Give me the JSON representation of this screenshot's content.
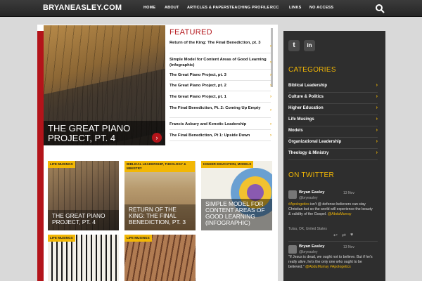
{
  "header": {
    "logo": "BRYANEASLEY.COM",
    "nav": [
      "HOME",
      "ABOUT",
      "ARTICLES & PAPERS",
      "TEACHING PROFILE",
      "RCC",
      "LINKS",
      "NO ACCESS"
    ],
    "search_icon": "search-icon"
  },
  "hero": {
    "title": "THE GREAT PIANO PROJECT, PT. 4",
    "next_icon": "chevron-right-icon"
  },
  "featured": {
    "heading": "FEATURED",
    "items": [
      "Return of the King: The Final Benediction, pt. 3",
      "Simple Model for Content Areas of Good Learning (infographic)",
      "The Great Piano Project, pt. 3",
      "The Great Piano Project, pt. 2",
      "The Great Piano Project, pt. 1",
      "The Final Benediction, Pt. 2: Coming Up Empty",
      "Francis Asbury and Kenotic Leadership",
      "The Final Benediction, Pt 1: Upside Down"
    ]
  },
  "cards": [
    {
      "tag": "LIFE MUSINGS",
      "title": "THE GREAT PIANO PROJECT, PT. 4"
    },
    {
      "tag": "BIBLICAL LEADERSHIP, THEOLOGY & MINISTRY",
      "title": "RETURN OF THE KING: THE FINAL BENEDICTION, PT. 3"
    },
    {
      "tag": "HIGHER EDUCATION, MODELS",
      "title": "SIMPLE MODEL FOR CONTENT AREAS OF GOOD LEARNING (INFOGRAPHIC)"
    },
    {
      "tag": "LIFE MUSINGS",
      "title": ""
    },
    {
      "tag": "LIFE MUSINGS",
      "title": ""
    }
  ],
  "sidebar": {
    "social": [
      "t",
      "in"
    ],
    "categories_heading": "CATEGORIES",
    "categories": [
      "Biblical Leadership",
      "Culture & Politics",
      "Higher Education",
      "Life Musings",
      "Models",
      "Organizational Leadership",
      "Theology & Ministry"
    ],
    "twitter_heading": "ON TWITTER",
    "tweets": [
      {
        "name": "Bryan Easley",
        "handle": "@bryeasley",
        "date": "13 Nov",
        "text_link1": "#Apologetics",
        "text": " isn't @ defense believers can stay Christian but so the world will experience the beauty & validity of the Gospel.",
        "text_link2": "@AbduMurray",
        "location": "Tulsa, OK, United States"
      },
      {
        "name": "Bryan Easley",
        "handle": "@bryeasley",
        "date": "13 Nov",
        "text": "\"If Jesus is dead, we ought not to believe. But if he's really alive, he's the only one who ought to be believed.\"",
        "text_link1": "@AbduMurray",
        "text_link2": "#Apologetics"
      }
    ]
  }
}
